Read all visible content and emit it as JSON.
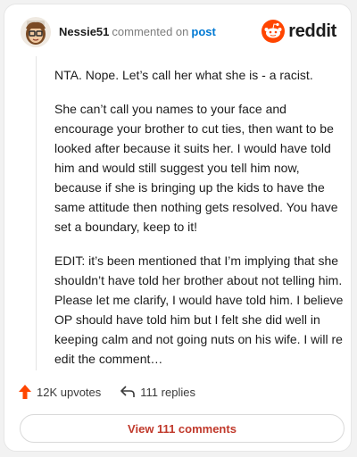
{
  "comment": {
    "username": "Nessie51",
    "action_text": "commented on",
    "post_link": "post",
    "paragraphs": [
      "NTA. Nope. Let’s call her what she is - a racist.",
      "She can’t call you names to your face and encourage your brother to cut ties, then want to be looked after because it suits her. I would have told him and would still suggest you tell him now, because if she is bringing up the kids to have the same attitude then nothing gets resolved. You have set a boundary, keep to it!",
      "EDIT: it’s been mentioned that I’m implying that she shouldn’t have told her brother about not telling him. Please let me clarify, I would have told him. I believe OP should have told him but I felt she did well in keeping calm and not going nuts on his wife. I will re edit the comment…"
    ],
    "upvotes": "12K upvotes",
    "replies": "111 replies",
    "view_button": "View 111 comments"
  },
  "brand": {
    "name": "reddit",
    "accent": "#ff4500",
    "link_color": "#0079d3",
    "icons": [
      "reddit-logo-icon",
      "upvote-arrow-icon",
      "reply-arrow-icon"
    ]
  }
}
